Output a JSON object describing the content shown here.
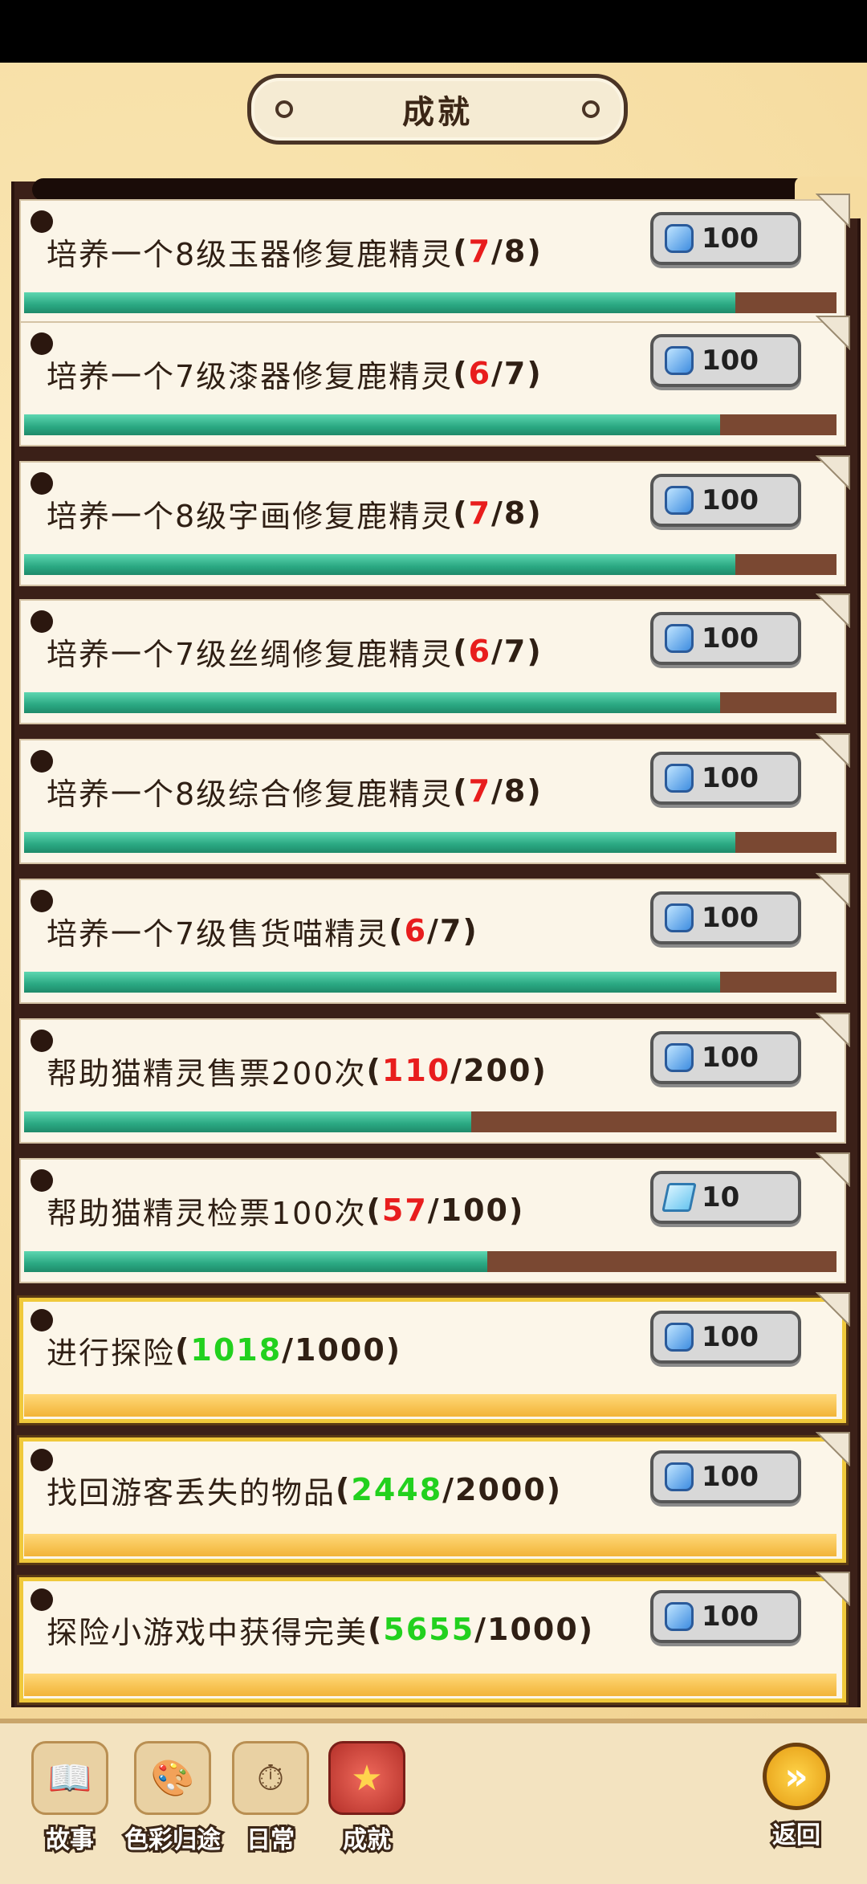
{
  "header": {
    "title": "成就"
  },
  "achievements": [
    {
      "text": "培养一个8级玉器修复鹿精灵",
      "open": "(",
      "current": "7",
      "sep": "/8",
      "close": ")",
      "current_color": "#e81d1d",
      "progress": 0.875,
      "reward_icon": "gem-icon",
      "reward": "100",
      "style": "normal"
    },
    {
      "text": "培养一个7级漆器修复鹿精灵",
      "open": "(",
      "current": "6",
      "sep": "/7",
      "close": ")",
      "current_color": "#e81d1d",
      "progress": 0.857,
      "reward_icon": "gem-icon",
      "reward": "100",
      "style": "normal"
    },
    {
      "text": "培养一个8级字画修复鹿精灵",
      "open": "(",
      "current": "7",
      "sep": "/8",
      "close": ")",
      "current_color": "#e81d1d",
      "progress": 0.875,
      "reward_icon": "gem-icon",
      "reward": "100",
      "style": "normal"
    },
    {
      "text": "培养一个7级丝绸修复鹿精灵",
      "open": "(",
      "current": "6",
      "sep": "/7",
      "close": ")",
      "current_color": "#e81d1d",
      "progress": 0.857,
      "reward_icon": "gem-icon",
      "reward": "100",
      "style": "normal"
    },
    {
      "text": "培养一个8级综合修复鹿精灵",
      "open": "(",
      "current": "7",
      "sep": "/8",
      "close": ")",
      "current_color": "#e81d1d",
      "progress": 0.875,
      "reward_icon": "gem-icon",
      "reward": "100",
      "style": "normal"
    },
    {
      "text": "培养一个7级售货喵精灵",
      "open": "(",
      "current": "6",
      "sep": "/7",
      "close": ")",
      "current_color": "#e81d1d",
      "progress": 0.857,
      "reward_icon": "gem-icon",
      "reward": "100",
      "style": "normal"
    },
    {
      "text": "帮助猫精灵售票200次",
      "open": "(",
      "current": "110",
      "sep": "/200",
      "close": ")",
      "current_color": "#e81d1d",
      "progress": 0.55,
      "reward_icon": "gem-icon",
      "reward": "100",
      "style": "normal"
    },
    {
      "text": "帮助猫精灵检票100次",
      "open": "(",
      "current": "57",
      "sep": "/100",
      "close": ")",
      "current_color": "#e81d1d",
      "progress": 0.57,
      "reward_icon": "ticket-icon",
      "reward": "10",
      "style": "normal"
    },
    {
      "text": "进行探险",
      "open": "(",
      "current": "1018",
      "sep": "/1000",
      "close": ")",
      "current_color": "#22d11e",
      "progress": 1.0,
      "reward_icon": "gem-icon",
      "reward": "100",
      "style": "gold"
    },
    {
      "text": "找回游客丢失的物品",
      "open": "(",
      "current": "2448",
      "sep": "/2000",
      "close": ")",
      "current_color": "#22d11e",
      "progress": 1.0,
      "reward_icon": "gem-icon",
      "reward": "100",
      "style": "gold"
    },
    {
      "text": "探险小游戏中获得完美",
      "open": "(",
      "current": "5655",
      "sep": "/1000",
      "close": ")",
      "current_color": "#22d11e",
      "progress": 1.0,
      "reward_icon": "gem-icon",
      "reward": "100",
      "style": "gold"
    }
  ],
  "nav": [
    {
      "label": "故事",
      "icon": "book-icon",
      "active": false
    },
    {
      "label": "色彩归途",
      "icon": "palette-icon",
      "active": false
    },
    {
      "label": "日常",
      "icon": "clock-icon",
      "active": false
    },
    {
      "label": "成就",
      "icon": "medal-icon",
      "active": true
    }
  ],
  "back": {
    "label": "返回",
    "icon": "back-arrow-icon"
  }
}
